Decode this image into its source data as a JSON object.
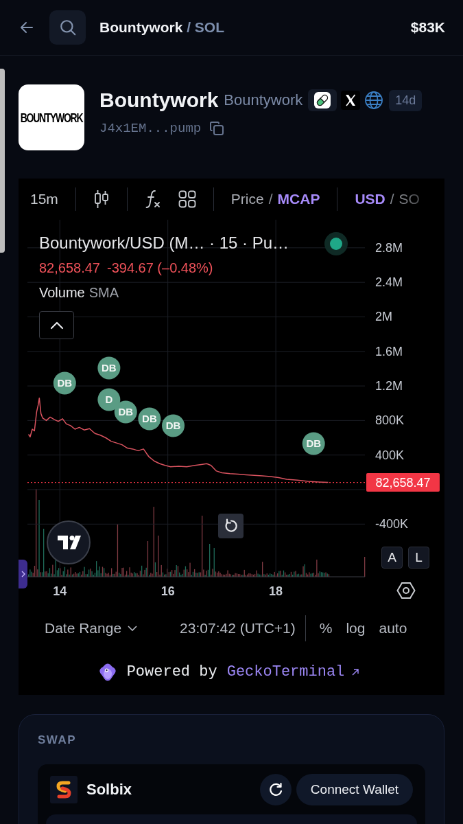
{
  "header": {
    "base": "Bountywork",
    "quote": "/ SOL",
    "market_cap": "$83K"
  },
  "token": {
    "logo_text": "BOUNTYWORK",
    "name": "Bountywork",
    "symbol": "Bountywork",
    "links": [
      {
        "kind": "pill"
      },
      {
        "kind": "x"
      },
      {
        "kind": "globe"
      }
    ],
    "age": "14d",
    "address": "J4x1EM...pump"
  },
  "chart_toolbar": {
    "interval": "15m",
    "tools": [
      {
        "kind": "candles"
      },
      {
        "kind": "indicators"
      },
      {
        "kind": "layout"
      }
    ],
    "value_toggle": {
      "options": [
        {
          "label": "Price",
          "selected": false
        },
        {
          "label": "MCAP",
          "selected": true
        }
      ],
      "separator": "/"
    },
    "currency_toggle": {
      "options": [
        {
          "label": "USD",
          "selected": true
        },
        {
          "label": "SO",
          "selected": false
        }
      ],
      "separator": "/"
    }
  },
  "chart": {
    "legend": {
      "title": "Bountywork/USD (M… · 15 · Pu…",
      "live": true,
      "price": "82,658.47",
      "change": "-394.67 (–0.48%)",
      "indicator": "Volume",
      "indicator_setting": "SMA"
    },
    "chart_data": {
      "type": "line",
      "x": [
        13.42,
        13.45,
        13.49,
        13.53,
        13.57,
        13.6,
        13.62,
        13.65,
        13.68,
        13.75,
        13.82,
        13.9,
        13.97,
        14.05,
        14.12,
        14.2,
        14.28,
        14.36,
        14.45,
        14.55,
        14.65,
        14.75,
        14.85,
        14.95,
        15.05,
        15.15,
        15.25,
        15.35,
        15.45,
        15.55,
        15.65,
        15.75,
        15.85,
        15.95,
        16.05,
        16.2,
        16.35,
        16.5,
        16.62,
        16.72,
        16.8,
        16.9,
        17.0,
        17.15,
        17.3,
        17.45,
        17.6,
        17.75,
        17.9,
        18.05,
        18.2,
        18.4,
        18.6,
        18.8,
        18.97
      ],
      "series": [
        {
          "color": "#d9535f",
          "values": [
            640000,
            610000,
            700000,
            680000,
            900000,
            980000,
            1060000,
            880000,
            830000,
            800000,
            840000,
            810000,
            790000,
            820000,
            760000,
            740000,
            700000,
            720000,
            690000,
            705000,
            650000,
            630000,
            600000,
            560000,
            540000,
            520000,
            480000,
            470000,
            450000,
            470000,
            380000,
            330000,
            300000,
            280000,
            265000,
            270000,
            265000,
            280000,
            290000,
            300000,
            280000,
            215000,
            195000,
            185000,
            180000,
            172000,
            165000,
            158000,
            150000,
            140000,
            120000,
            110000,
            95000,
            88000,
            83000
          ]
        }
      ],
      "xlim": [
        13.4,
        19.65
      ],
      "ylim": [
        -1010000,
        3125000
      ],
      "grid": true,
      "xticks": [
        14,
        16,
        18
      ],
      "yticks": [
        {
          "value": 2800000,
          "label": "2.8M"
        },
        {
          "value": 2400000,
          "label": "2.4M"
        },
        {
          "value": 2000000,
          "label": "2M"
        },
        {
          "value": 1600000,
          "label": "1.6M"
        },
        {
          "value": 1200000,
          "label": "1.2M"
        },
        {
          "value": 800000,
          "label": "800K"
        },
        {
          "value": 400000,
          "label": "400K"
        },
        {
          "value": -400000,
          "label": "-400K"
        }
      ],
      "ref_lines": [
        {
          "axis": "y",
          "value": 82658.47,
          "label": "82,658.47"
        }
      ],
      "annotations": [
        {
          "x": 14.09,
          "y": 1233000,
          "text": "DB"
        },
        {
          "x": 14.91,
          "y": 1408000,
          "text": "DB"
        },
        {
          "x": 14.91,
          "y": 1042000,
          "text": "D"
        },
        {
          "x": 15.22,
          "y": 899000,
          "text": "DB"
        },
        {
          "x": 15.66,
          "y": 819000,
          "text": "DB"
        },
        {
          "x": 16.1,
          "y": 740000,
          "text": "DB"
        },
        {
          "x": 18.7,
          "y": 533000,
          "text": "DB"
        }
      ]
    },
    "scale_buttons": [
      "A",
      "L"
    ]
  },
  "chart_footer": {
    "date_range": "Date Range",
    "time": "23:07:42 (UTC+1)",
    "options": [
      "%",
      "log",
      "auto"
    ]
  },
  "attribution": {
    "prefix": "Powered by",
    "link": "GeckoTerminal"
  },
  "swap": {
    "title": "SWAP",
    "provider": "Solbix",
    "action": "Connect Wallet"
  }
}
